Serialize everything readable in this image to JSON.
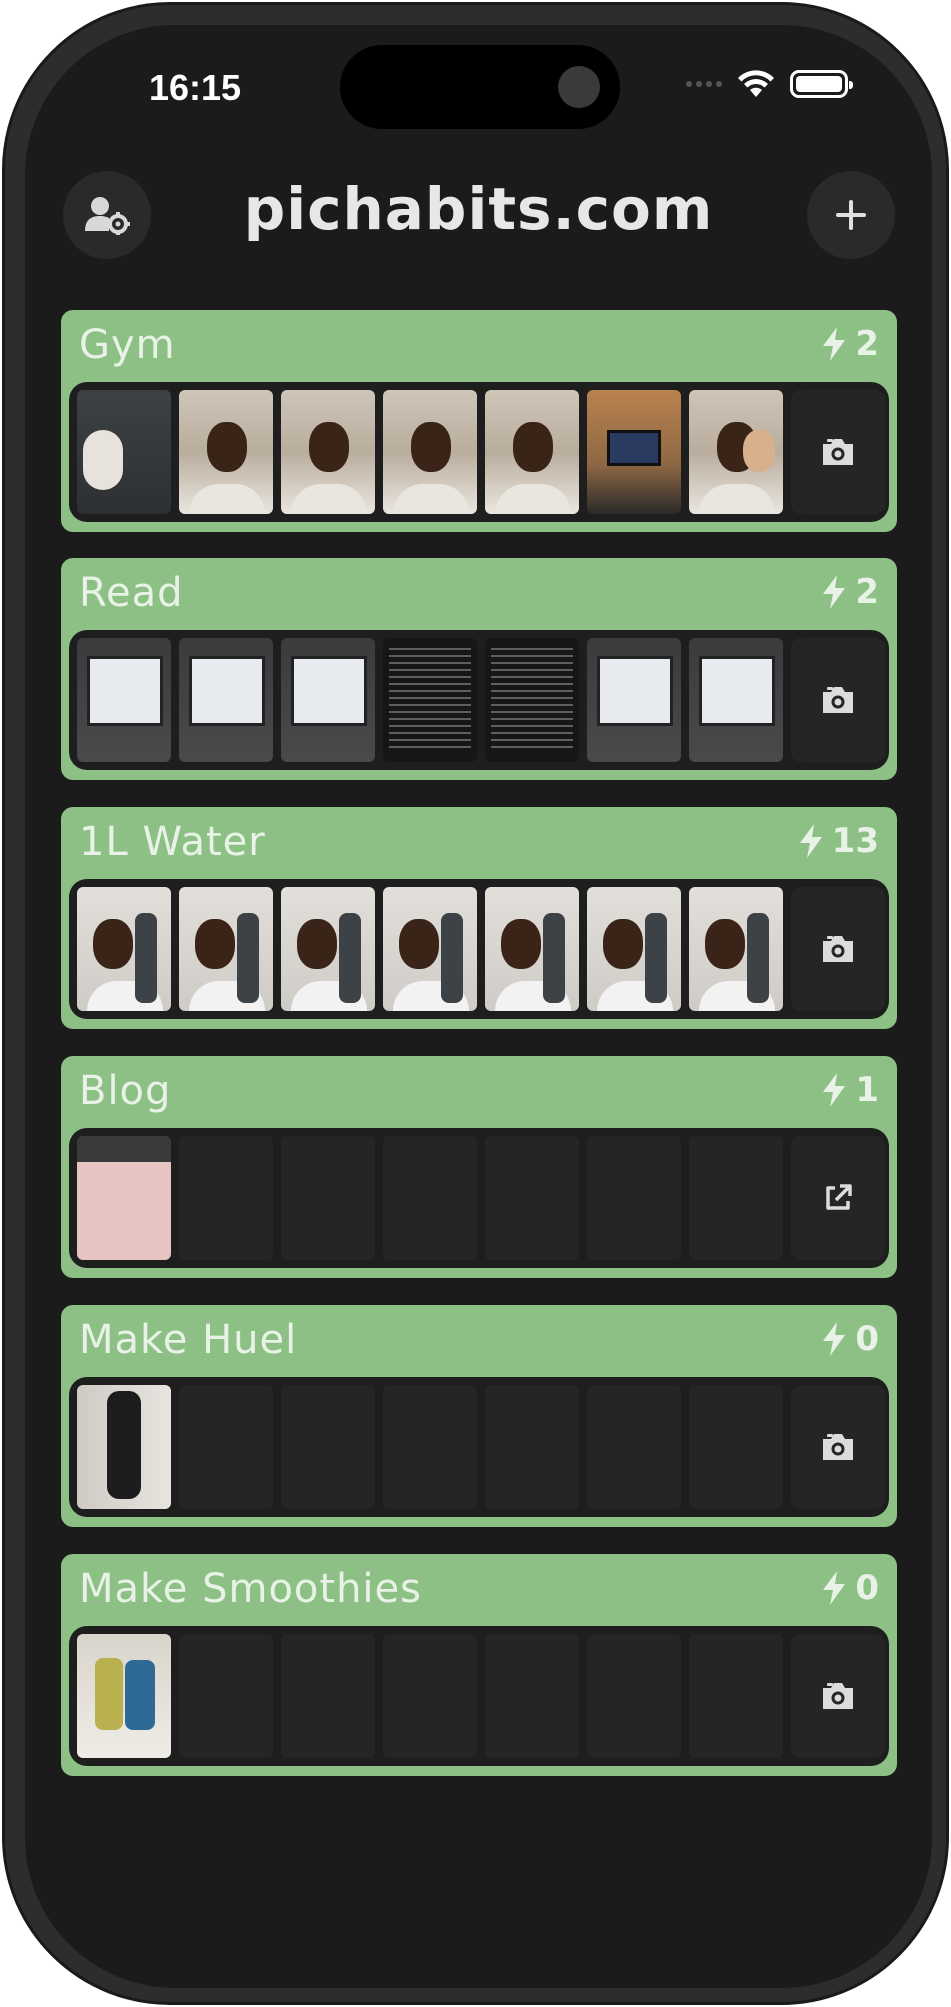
{
  "status_bar": {
    "time": "16:15"
  },
  "header": {
    "title": "pichabits.com",
    "left_icon": "user-settings-icon",
    "right_icon": "plus-icon"
  },
  "colors": {
    "card_green": "#8cc084",
    "background": "#1b1b1c",
    "tray": "#1e1e1f"
  },
  "habits": [
    {
      "name": "Gym",
      "streak": "2",
      "action_icon": "camera-icon",
      "photos": [
        "gym-hand-photo",
        "gym-selfie",
        "gym-selfie",
        "gym-selfie",
        "gym-selfie",
        "gym-tv-photo",
        "gym-group-selfie"
      ]
    },
    {
      "name": "Read",
      "streak": "2",
      "action_icon": "camera-icon",
      "photos": [
        "screen-photo",
        "screen-photo",
        "screen-photo",
        "book-page",
        "book-page",
        "screen-photo",
        "screen-photo"
      ]
    },
    {
      "name": "1L Water",
      "streak": "13",
      "action_icon": "camera-icon",
      "photos": [
        "bottle-selfie",
        "bottle-selfie",
        "bottle-selfie",
        "bottle-selfie",
        "bottle-selfie",
        "bottle-selfie",
        "bottle-selfie"
      ]
    },
    {
      "name": "Blog",
      "streak": "1",
      "action_icon": "external-link-icon",
      "photos": [
        "blog-photo"
      ]
    },
    {
      "name": "Make Huel",
      "streak": "0",
      "action_icon": "camera-icon",
      "photos": [
        "huel-bottle-photo"
      ]
    },
    {
      "name": "Make Smoothies",
      "streak": "0",
      "action_icon": "camera-icon",
      "photos": [
        "smoothie-photo"
      ]
    }
  ]
}
